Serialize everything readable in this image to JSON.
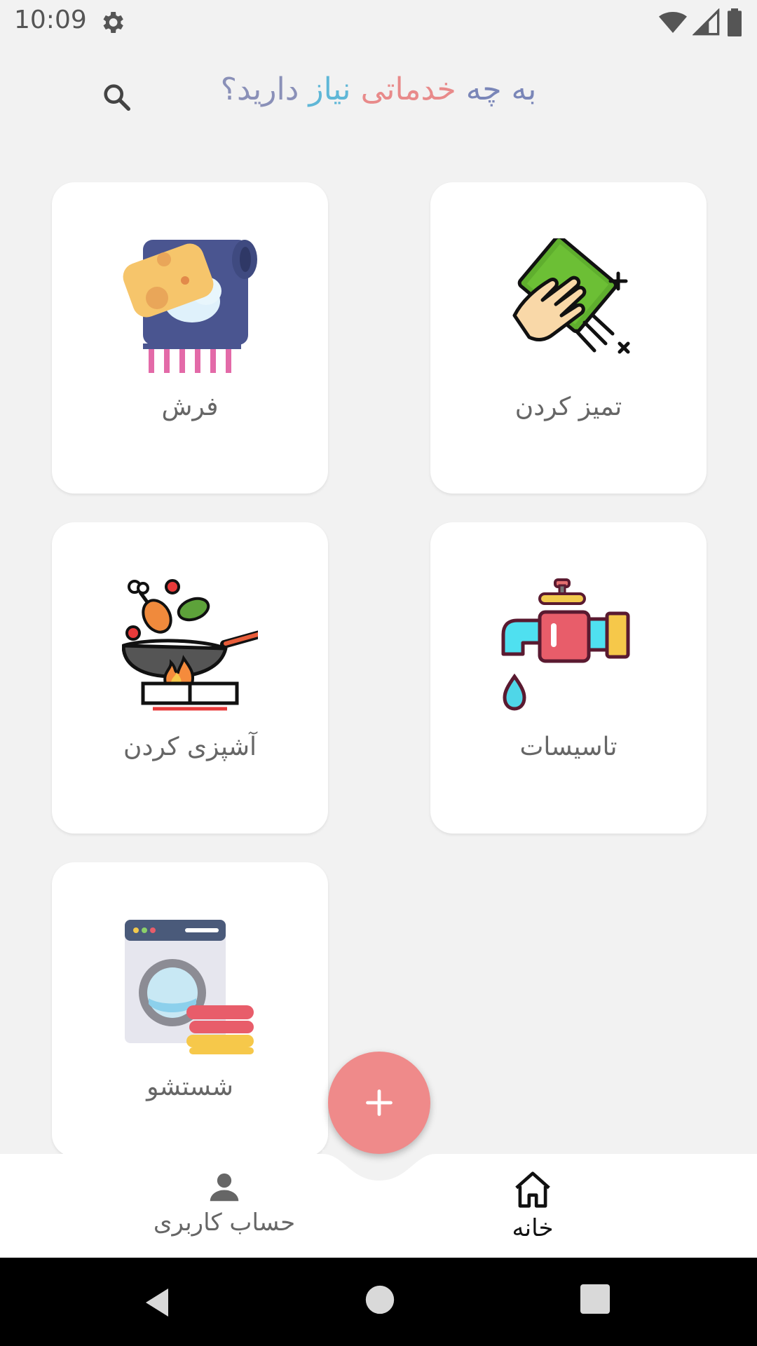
{
  "status_bar": {
    "time": "10:09"
  },
  "header": {
    "title_part1": "به چه",
    "title_part2": "خدماتی",
    "title_part3": "نیاز",
    "title_part4": "دارید؟"
  },
  "services": [
    {
      "label": "تمیز کردن",
      "icon": "cleaning-hand-icon"
    },
    {
      "label": "فرش",
      "icon": "carpet-icon"
    },
    {
      "label": "تاسیسات",
      "icon": "faucet-icon"
    },
    {
      "label": "آشپزی کردن",
      "icon": "cooking-pan-icon"
    },
    {
      "label": "شستشو",
      "icon": "washing-machine-icon"
    }
  ],
  "fab": {
    "icon": "plus-icon",
    "color": "#ef8a8a"
  },
  "bottom_nav": {
    "home_label": "خانه",
    "account_label": "حساب کاربری"
  }
}
